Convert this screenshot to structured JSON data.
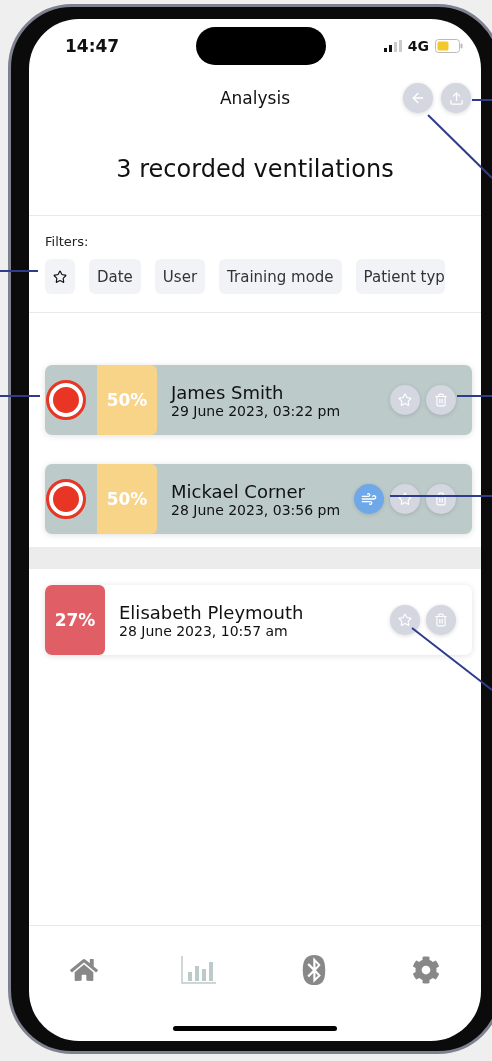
{
  "status_bar": {
    "time": "14:47",
    "network": "4G"
  },
  "header": {
    "title": "Analysis"
  },
  "headline": "3 recorded ventilations",
  "filters": {
    "label": "Filters:",
    "chips": [
      {
        "kind": "star"
      },
      {
        "kind": "text",
        "label": "Date"
      },
      {
        "kind": "text",
        "label": "User"
      },
      {
        "kind": "text",
        "label": "Training mode"
      },
      {
        "kind": "text",
        "label": "Patient typ"
      }
    ]
  },
  "records": [
    {
      "name": "James Smith",
      "date": "29 June 2023, 03:22 pm",
      "score": "50%",
      "color": "#f7d488",
      "recording": true,
      "highlighted": true,
      "ventilation": false
    },
    {
      "name": "Mickael Corner",
      "date": "28 June 2023, 03:56 pm",
      "score": "50%",
      "color": "#f7d488",
      "recording": true,
      "highlighted": true,
      "ventilation": true
    },
    {
      "name": "Elisabeth Pleymouth",
      "date": "28 June 2023, 10:57 am",
      "score": "27%",
      "color": "#e05f66",
      "recording": false,
      "highlighted": false,
      "ventilation": false
    }
  ],
  "nav": [
    {
      "kind": "home",
      "selected": false
    },
    {
      "kind": "chart",
      "selected": true
    },
    {
      "kind": "bluetooth",
      "selected": false
    },
    {
      "kind": "settings",
      "selected": false
    }
  ]
}
